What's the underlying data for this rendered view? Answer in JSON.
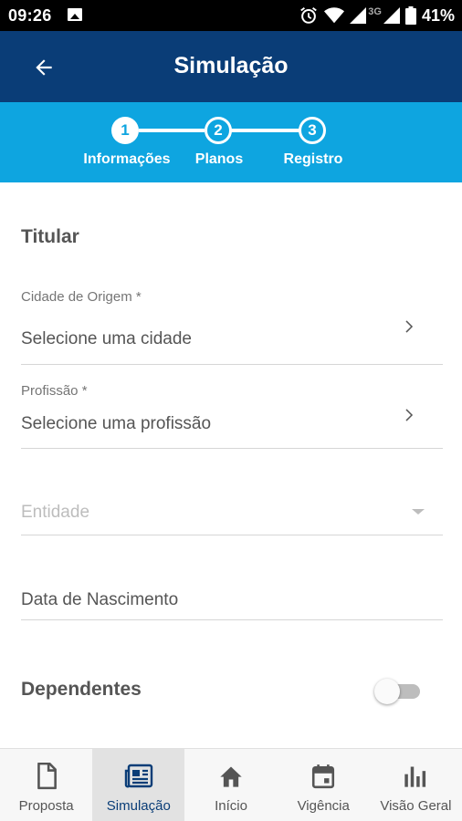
{
  "status_bar": {
    "time": "09:26",
    "network": "3G",
    "battery": "41%"
  },
  "app_bar": {
    "title": "Simulação",
    "back_icon": "arrow-left-icon"
  },
  "stepper": {
    "steps": [
      {
        "number": "1",
        "label": "Informações",
        "active": true
      },
      {
        "number": "2",
        "label": "Planos",
        "active": false
      },
      {
        "number": "3",
        "label": "Registro",
        "active": false
      }
    ]
  },
  "form": {
    "section_title": "Titular",
    "cidade": {
      "label": "Cidade de Origem *",
      "value": "Selecione uma cidade"
    },
    "profissao": {
      "label": "Profissão *",
      "value": "Selecione uma profissão"
    },
    "entidade": {
      "placeholder": "Entidade"
    },
    "nascimento": {
      "placeholder": "Data de Nascimento"
    },
    "dependentes": {
      "label": "Dependentes",
      "enabled": false
    }
  },
  "bottom_nav": {
    "items": [
      {
        "label": "Proposta",
        "icon": "document-icon",
        "active": false
      },
      {
        "label": "Simulação",
        "icon": "newspaper-icon",
        "active": true
      },
      {
        "label": "Início",
        "icon": "home-icon",
        "active": false
      },
      {
        "label": "Vigência",
        "icon": "calendar-icon",
        "active": false
      },
      {
        "label": "Visão Geral",
        "icon": "bar-chart-icon",
        "active": false
      }
    ]
  },
  "colors": {
    "app_bar": "#0a3d77",
    "stepper": "#0ea5e0",
    "active_nav": "#0a3d77"
  }
}
